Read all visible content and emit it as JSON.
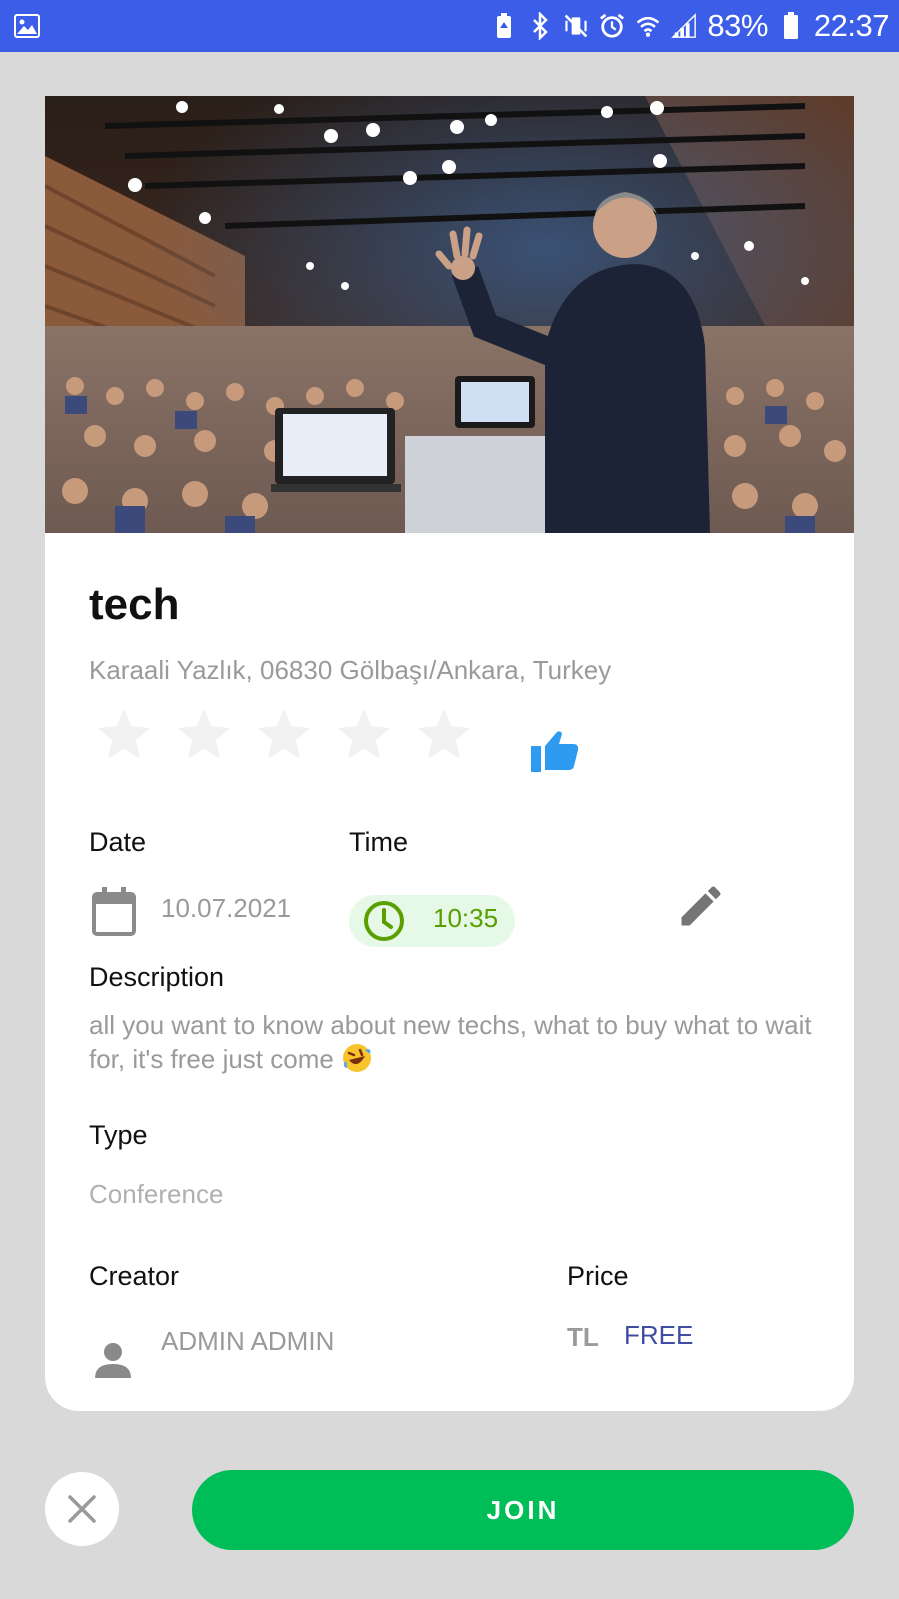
{
  "status_bar": {
    "battery_percent": "83%",
    "time": "22:37",
    "icons": [
      "gallery-icon",
      "battery-saver-icon",
      "bluetooth-icon",
      "vibrate-icon",
      "alarm-icon",
      "wifi-icon",
      "signal-icon",
      "battery-icon"
    ]
  },
  "event": {
    "title": "tech",
    "address": "Karaali Yazlık, 06830 Gölbaşı/Ankara, Turkey",
    "rating": 0,
    "rating_max": 5,
    "date_label": "Date",
    "date_value": "10.07.2021",
    "time_label": "Time",
    "time_value": "10:35",
    "description_label": "Description",
    "description_text": "all you want to know about new techs, what to buy what to wait for, it's free just come",
    "type_label": "Type",
    "type_value": "Conference",
    "creator_label": "Creator",
    "creator_name": "ADMIN ADMIN",
    "price_label": "Price",
    "price_currency": "TL",
    "price_value": "FREE"
  },
  "actions": {
    "join_label": "JOIN",
    "close_icon": "close-icon"
  },
  "colors": {
    "status_bar": "#3b5de7",
    "join_button": "#00be57",
    "time_text": "#57a000",
    "time_pill_bg": "#e6f8e6",
    "like_icon": "#2f9bf0",
    "price_value": "#3f4ca3"
  }
}
